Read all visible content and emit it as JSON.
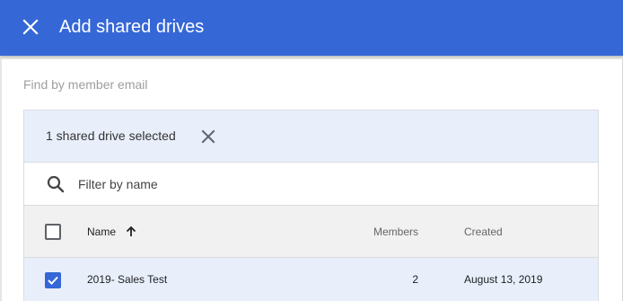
{
  "dialog": {
    "title": "Add shared drives",
    "close_icon": "close-icon",
    "accent_color": "#3567d6"
  },
  "member_search": {
    "placeholder": "Find by member email",
    "value": ""
  },
  "selection": {
    "text": "1 shared drive selected",
    "clear_icon": "close-icon"
  },
  "filter": {
    "placeholder": "Filter by name",
    "value": "",
    "icon": "search-icon"
  },
  "table": {
    "columns": {
      "name": "Name",
      "members": "Members",
      "created": "Created"
    },
    "sort": {
      "column": "Name",
      "direction": "ascending",
      "icon": "arrow-up-icon"
    },
    "rows": [
      {
        "checked": true,
        "name": "2019- Sales Test",
        "members": "2",
        "created": "August 13, 2019"
      }
    ]
  }
}
